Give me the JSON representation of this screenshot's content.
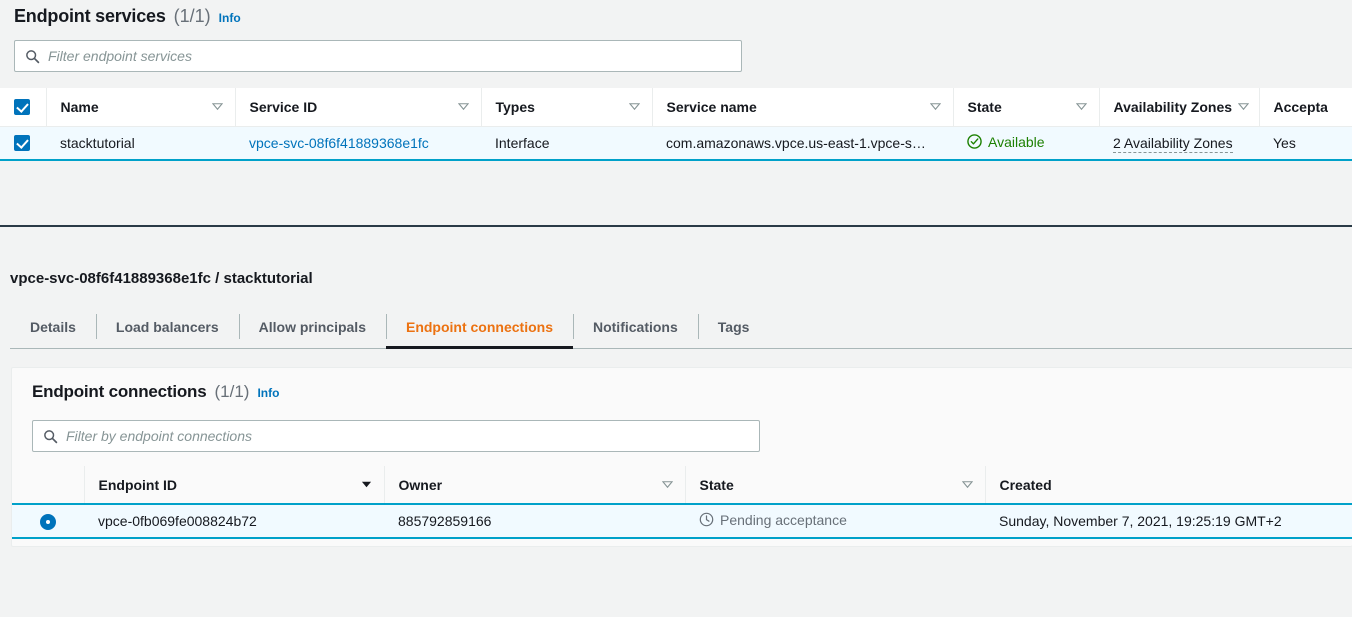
{
  "top_panel": {
    "title": "Endpoint services",
    "count": "(1/1)",
    "info_label": "Info",
    "filter": {
      "placeholder": "Filter endpoint services",
      "value": ""
    },
    "columns": [
      {
        "label": "Name",
        "sort": "unsorted"
      },
      {
        "label": "Service ID",
        "sort": "unsorted"
      },
      {
        "label": "Types",
        "sort": "unsorted"
      },
      {
        "label": "Service name",
        "sort": "unsorted"
      },
      {
        "label": "State",
        "sort": "unsorted"
      },
      {
        "label": "Availability Zones",
        "sort": "unsorted"
      },
      {
        "label": "Accepta",
        "sort": "none"
      }
    ],
    "rows": [
      {
        "selected": true,
        "name": "stacktutorial",
        "service_id": "vpce-svc-08f6f41889368e1fc",
        "types": "Interface",
        "service_name": "com.amazonaws.vpce.us-east-1.vpce-s…",
        "state": "Available",
        "state_icon": "check-circle-icon",
        "availability_zones": "2 Availability Zones",
        "acceptance": "Yes"
      }
    ]
  },
  "splitter": {
    "name": "panel-resize-handle"
  },
  "detail": {
    "title": "vpce-svc-08f6f41889368e1fc / stacktutorial",
    "tabs": [
      {
        "label": "Details",
        "active": false
      },
      {
        "label": "Load balancers",
        "active": false
      },
      {
        "label": "Allow principals",
        "active": false
      },
      {
        "label": "Endpoint connections",
        "active": true
      },
      {
        "label": "Notifications",
        "active": false
      },
      {
        "label": "Tags",
        "active": false
      }
    ]
  },
  "connections_panel": {
    "title": "Endpoint connections",
    "count": "(1/1)",
    "info_label": "Info",
    "filter": {
      "placeholder": "Filter by endpoint connections",
      "value": ""
    },
    "columns": [
      {
        "label": "Endpoint ID",
        "sort": "desc"
      },
      {
        "label": "Owner",
        "sort": "unsorted"
      },
      {
        "label": "State",
        "sort": "unsorted"
      },
      {
        "label": "Created",
        "sort": "none"
      }
    ],
    "rows": [
      {
        "selected": true,
        "endpoint_id": "vpce-0fb069fe008824b72",
        "owner": "885792859166",
        "state": "Pending acceptance",
        "state_icon": "clock-icon",
        "created": "Sunday, November 7, 2021, 19:25:19 GMT+2"
      }
    ]
  },
  "colors": {
    "link": "#0073bb",
    "accent_orange": "#ec7211",
    "selected_row_bg": "#f1faff",
    "selected_border": "#00a1c9",
    "status_available": "#1d8102",
    "status_pending": "#687078",
    "page_bg": "#f2f3f3"
  }
}
